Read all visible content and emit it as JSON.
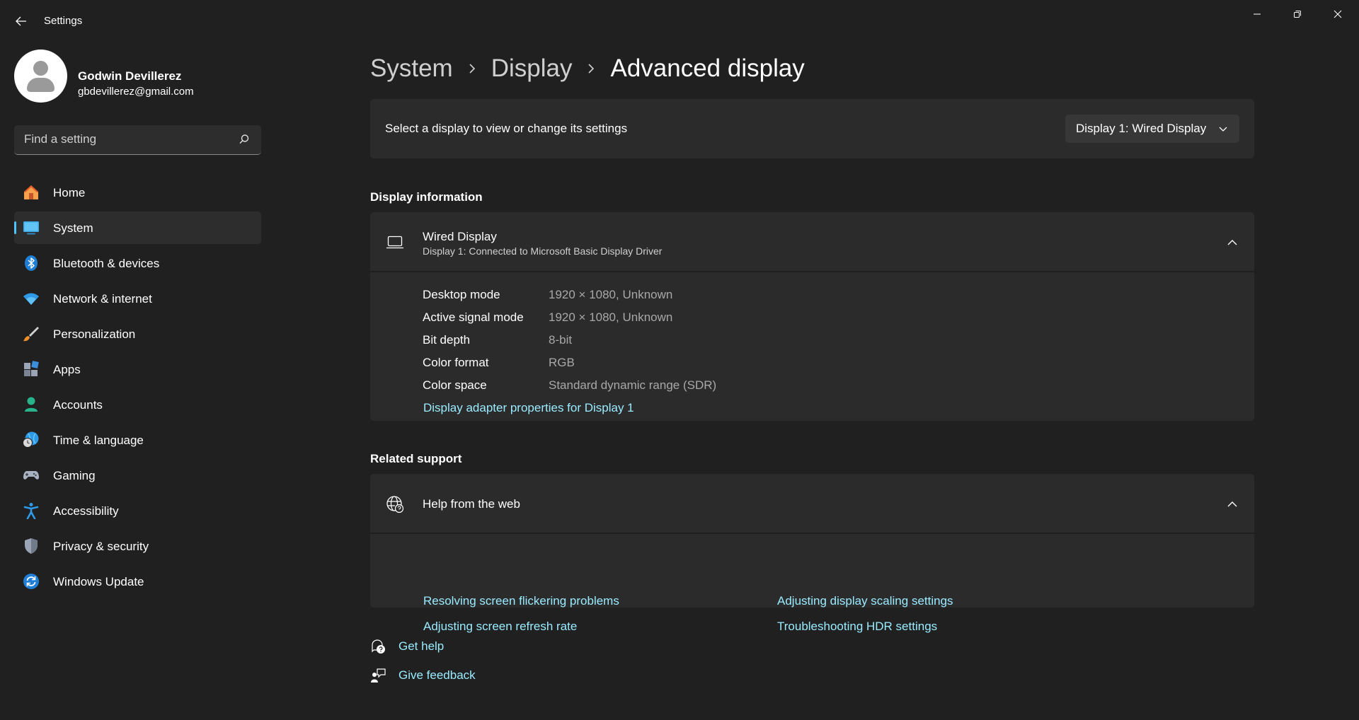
{
  "window": {
    "title": "Settings",
    "controls": [
      "minimize",
      "restore",
      "close"
    ]
  },
  "profile": {
    "name": "Godwin Devillerez",
    "email": "gbdevillerez@gmail.com"
  },
  "search": {
    "placeholder": "Find a setting"
  },
  "sidebar": {
    "items": [
      {
        "label": "Home",
        "icon": "home-icon",
        "active": false
      },
      {
        "label": "System",
        "icon": "system-icon",
        "active": true
      },
      {
        "label": "Bluetooth & devices",
        "icon": "bluetooth-icon",
        "active": false
      },
      {
        "label": "Network & internet",
        "icon": "wifi-icon",
        "active": false
      },
      {
        "label": "Personalization",
        "icon": "brush-icon",
        "active": false
      },
      {
        "label": "Apps",
        "icon": "apps-icon",
        "active": false
      },
      {
        "label": "Accounts",
        "icon": "person-icon",
        "active": false
      },
      {
        "label": "Time & language",
        "icon": "globe-clock-icon",
        "active": false
      },
      {
        "label": "Gaming",
        "icon": "gamepad-icon",
        "active": false
      },
      {
        "label": "Accessibility",
        "icon": "accessibility-icon",
        "active": false
      },
      {
        "label": "Privacy & security",
        "icon": "shield-icon",
        "active": false
      },
      {
        "label": "Windows Update",
        "icon": "update-icon",
        "active": false
      }
    ]
  },
  "breadcrumb": [
    "System",
    "Display",
    "Advanced display"
  ],
  "display_select": {
    "label": "Select a display to view or change its settings",
    "value": "Display 1: Wired Display"
  },
  "display_information": {
    "section_title": "Display information",
    "name": "Wired Display",
    "subtitle": "Display 1: Connected to Microsoft Basic Display Driver",
    "rows": [
      {
        "key": "Desktop mode",
        "value": "1920 × 1080, Unknown"
      },
      {
        "key": "Active signal mode",
        "value": "1920 × 1080, Unknown"
      },
      {
        "key": "Bit depth",
        "value": "8-bit"
      },
      {
        "key": "Color format",
        "value": "RGB"
      },
      {
        "key": "Color space",
        "value": "Standard dynamic range (SDR)"
      }
    ],
    "adapter_link": "Display adapter properties for Display 1"
  },
  "related_support": {
    "section_title": "Related support",
    "help_title": "Help from the web",
    "links": [
      "Resolving screen flickering problems",
      "Adjusting display scaling settings",
      "Adjusting screen refresh rate",
      "Troubleshooting HDR settings"
    ]
  },
  "footer": {
    "get_help": "Get help",
    "give_feedback": "Give feedback"
  },
  "colors": {
    "background": "#202020",
    "card": "#2b2b2b",
    "accent": "#4cc2ff",
    "link": "#99ebff"
  }
}
